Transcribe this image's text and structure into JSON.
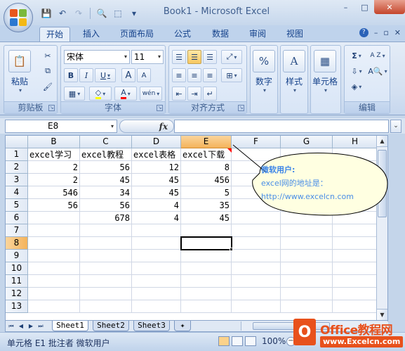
{
  "window": {
    "title": "Book1 - Microsoft Excel",
    "controls": {
      "minimize": "–",
      "maximize": "□",
      "close": "✕"
    }
  },
  "qat": {
    "save": "💾",
    "undo": "↶",
    "redo": "↷",
    "preview": "🔍",
    "more": "▾"
  },
  "tabs": [
    "开始",
    "插入",
    "页面布局",
    "公式",
    "数据",
    "审阅",
    "视图"
  ],
  "active_tab": "开始",
  "ribbon": {
    "clipboard": {
      "label": "剪贴板",
      "paste": "粘贴"
    },
    "font": {
      "label": "字体",
      "name": "宋体",
      "size": "11",
      "bold": "B",
      "italic": "I",
      "underline": "U",
      "grow": "A",
      "shrink": "A",
      "fill_icon": "A",
      "color_icon": "A",
      "phonetic": "wén"
    },
    "alignment": {
      "label": "对齐方式"
    },
    "number": {
      "label": "数字",
      "symbol": "%"
    },
    "styles": {
      "label": "样式",
      "symbol": "A"
    },
    "cells": {
      "label": "单元格",
      "symbol": "▦"
    },
    "editing": {
      "label": "编辑",
      "sum": "Σ",
      "sort": "A Z",
      "find": "A"
    }
  },
  "formula_bar": {
    "name_box": "E8",
    "fx": "fx",
    "value": ""
  },
  "columns": [
    "B",
    "C",
    "D",
    "E",
    "F",
    "G",
    "H"
  ],
  "selected_column": "E",
  "rows": [
    "1",
    "2",
    "3",
    "4",
    "5",
    "6",
    "7",
    "8",
    "9",
    "10",
    "11",
    "12",
    "13"
  ],
  "selected_row": "8",
  "cells": [
    [
      "excel学习",
      "excel教程",
      "excel表格",
      "excel下载"
    ],
    [
      "2",
      "56",
      "12",
      "8"
    ],
    [
      "2",
      "45",
      "45",
      "456"
    ],
    [
      "546",
      "34",
      "45",
      "5"
    ],
    [
      "56",
      "56",
      "4",
      "35"
    ],
    [
      "",
      "678",
      "4",
      "45"
    ]
  ],
  "comment": {
    "author": "微软用户:",
    "line1": "excel网的地址是：",
    "line2": "http://www.excelcn.com"
  },
  "sheets": [
    "Sheet1",
    "Sheet2",
    "Sheet3"
  ],
  "active_sheet": "Sheet1",
  "status": {
    "text": "单元格 E1 批注者 微软用户",
    "zoom": "100%"
  },
  "watermark": {
    "top": "Office教程网",
    "bottom": "www.Excelcn.com",
    "badge": "O"
  },
  "colors": {
    "accent": "#e8511c",
    "selection": "#f4b35b",
    "comment_bg": "#ffffe1",
    "comment_text": "#4a8ee6"
  }
}
